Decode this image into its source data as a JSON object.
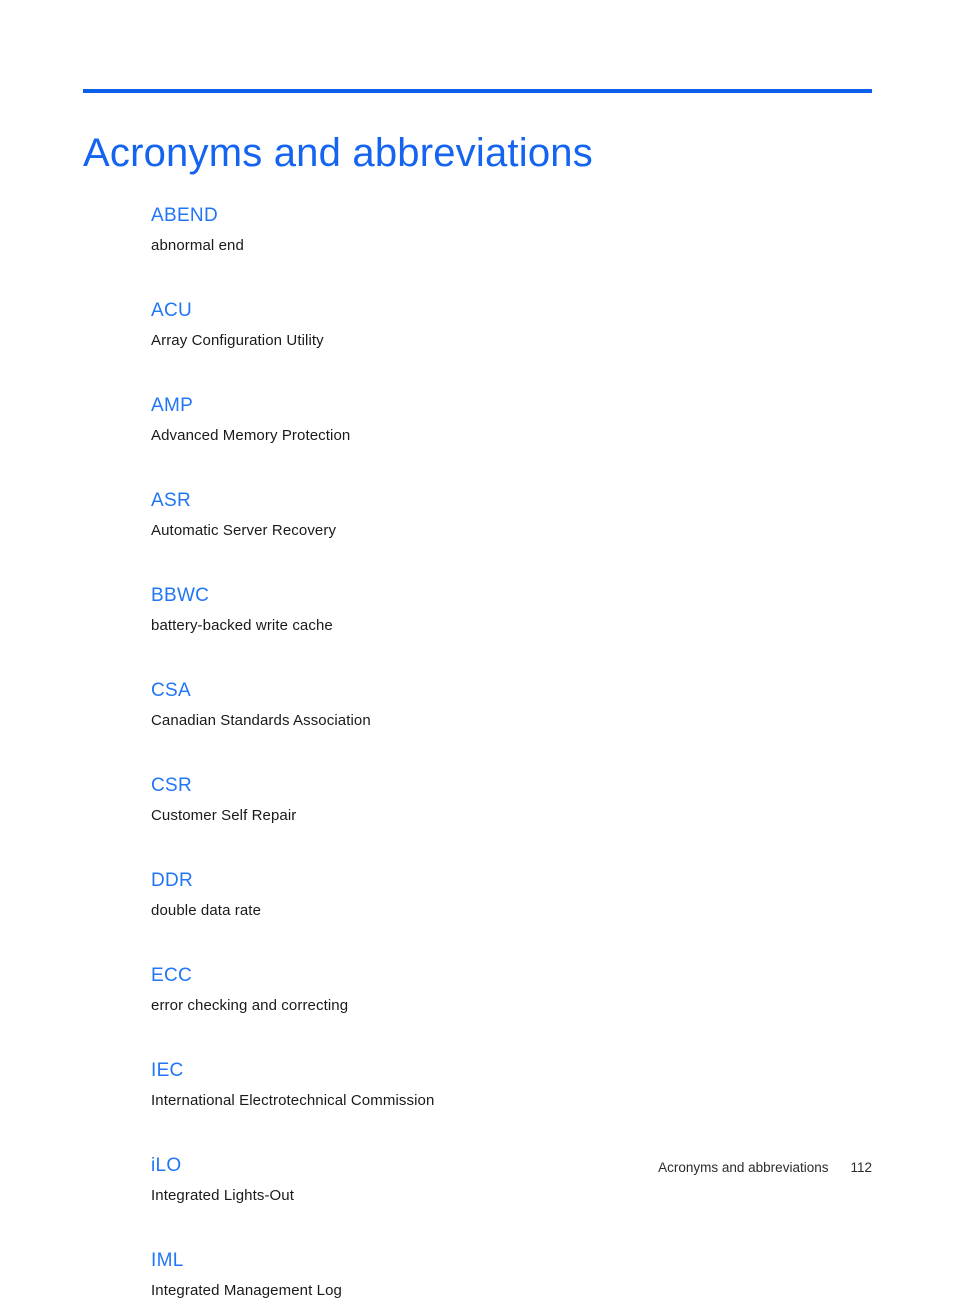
{
  "document": {
    "title": "Acronyms and abbreviations",
    "accent_color": "#0b5fe8",
    "title_color": "#1464f0",
    "term_color": "#2176f5",
    "definition_color": "#1a1a1a"
  },
  "glossary": {
    "entries": [
      {
        "term": "ABEND",
        "definition": "abnormal end"
      },
      {
        "term": "ACU",
        "definition": "Array Configuration Utility"
      },
      {
        "term": "AMP",
        "definition": "Advanced Memory Protection"
      },
      {
        "term": "ASR",
        "definition": "Automatic Server Recovery"
      },
      {
        "term": "BBWC",
        "definition": "battery-backed write cache"
      },
      {
        "term": "CSA",
        "definition": "Canadian Standards Association"
      },
      {
        "term": "CSR",
        "definition": "Customer Self Repair"
      },
      {
        "term": "DDR",
        "definition": "double data rate"
      },
      {
        "term": "ECC",
        "definition": "error checking and correcting"
      },
      {
        "term": "IEC",
        "definition": "International Electrotechnical Commission"
      },
      {
        "term": "iLO",
        "definition": "Integrated Lights-Out"
      },
      {
        "term": "IML",
        "definition": "Integrated Management Log"
      }
    ]
  },
  "footer": {
    "label": "Acronyms and abbreviations",
    "page_number": "112"
  }
}
